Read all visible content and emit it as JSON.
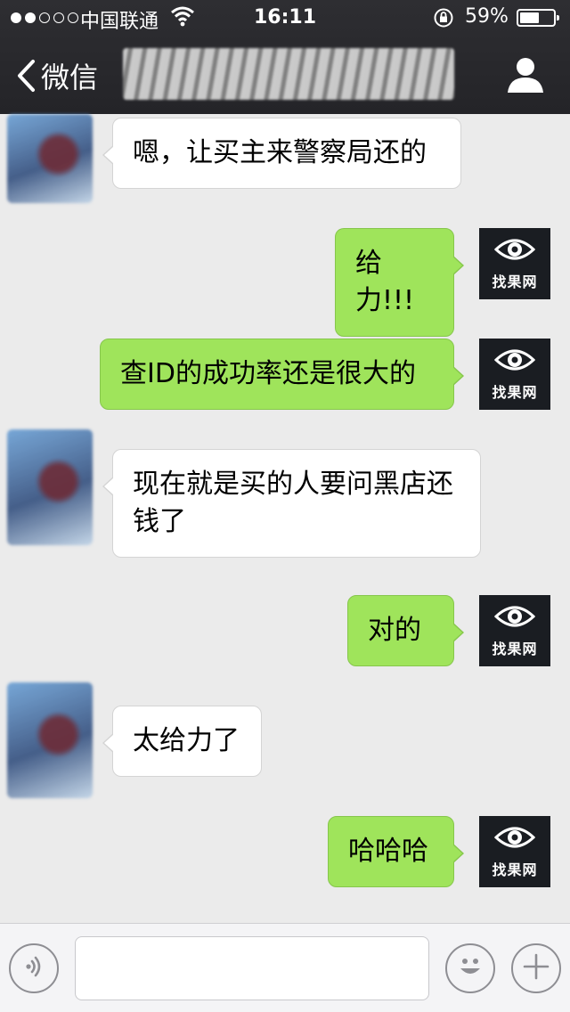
{
  "status_bar": {
    "carrier": "中国联通",
    "time": "16:11",
    "battery": "59%",
    "battery_level": 0.59,
    "signal_bars": 2,
    "icons": [
      "signal-dots-icon",
      "wifi-icon",
      "rotation-lock-icon",
      "battery-icon"
    ]
  },
  "nav": {
    "back_label": "微信",
    "title": "",
    "icons": [
      "chevron-left-icon",
      "profile-icon"
    ]
  },
  "messages": [
    {
      "side": "in",
      "text": "嗯，让买主来警察局还的"
    },
    {
      "side": "out",
      "text": "给力!!!"
    },
    {
      "side": "out",
      "text": "查ID的成功率还是很大的"
    },
    {
      "side": "in",
      "text": "现在就是买的人要问黑店还钱了"
    },
    {
      "side": "out",
      "text": "对的"
    },
    {
      "side": "in",
      "text": "太给力了"
    },
    {
      "side": "out",
      "text": "哈哈哈"
    }
  ],
  "my_avatar": {
    "brand_text": "找果网",
    "icon": "eye-icon"
  },
  "input_bar": {
    "value": "",
    "icons": [
      "voice-icon",
      "emoji-icon",
      "plus-icon"
    ]
  },
  "colors": {
    "nav_bg": "#2b2b2f",
    "chat_bg": "#ebebeb",
    "outgoing_bubble": "#9fe45b",
    "incoming_bubble": "#ffffff"
  }
}
